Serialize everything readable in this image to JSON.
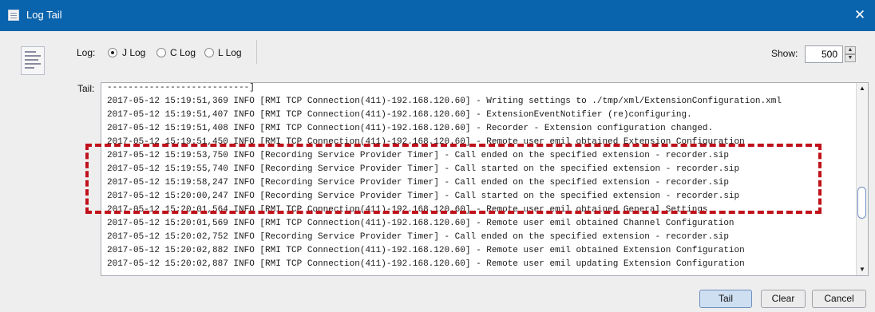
{
  "window": {
    "title": "Log Tail",
    "close_glyph": "✕"
  },
  "log_selector": {
    "label": "Log:",
    "options": [
      {
        "label": "J Log",
        "selected": true
      },
      {
        "label": "C Log",
        "selected": false
      },
      {
        "label": "L Log",
        "selected": false
      }
    ]
  },
  "show": {
    "label": "Show:",
    "value": "500"
  },
  "tail": {
    "label": "Tail:",
    "lines": [
      "---------------------------]",
      "2017-05-12 15:19:51,369 INFO [RMI TCP Connection(411)-192.168.120.60] - Writing settings to ./tmp/xml/ExtensionConfiguration.xml",
      "2017-05-12 15:19:51,407 INFO [RMI TCP Connection(411)-192.168.120.60] - ExtensionEventNotifier (re)configuring.",
      "2017-05-12 15:19:51,408 INFO [RMI TCP Connection(411)-192.168.120.60] - Recorder - Extension configuration changed.",
      "2017-05-12 15:19:51,450 INFO [RMI TCP Connection(411)-192.168.120.60] - Remote user emil obtained Extension Configuration",
      "2017-05-12 15:19:53,750 INFO [Recording Service Provider Timer] - Call ended on the specified extension - recorder.sip",
      "2017-05-12 15:19:55,740 INFO [Recording Service Provider Timer] - Call started on the specified extension - recorder.sip",
      "2017-05-12 15:19:58,247 INFO [Recording Service Provider Timer] - Call ended on the specified extension - recorder.sip",
      "2017-05-12 15:20:00,247 INFO [Recording Service Provider Timer] - Call started on the specified extension - recorder.sip",
      "2017-05-12 15:20:01,564 INFO [RMI TCP Connection(411)-192.168.120.60] - Remote user emil obtained General Settings",
      "2017-05-12 15:20:01,569 INFO [RMI TCP Connection(411)-192.168.120.60] - Remote user emil obtained Channel Configuration",
      "2017-05-12 15:20:02,752 INFO [Recording Service Provider Timer] - Call ended on the specified extension - recorder.sip",
      "2017-05-12 15:20:02,882 INFO [RMI TCP Connection(411)-192.168.120.60] - Remote user emil obtained Extension Configuration",
      "2017-05-12 15:20:02,887 INFO [RMI TCP Connection(411)-192.168.120.60] - Remote user emil updating Extension Configuration"
    ]
  },
  "buttons": {
    "tail": "Tail",
    "clear": "Clear",
    "cancel": "Cancel"
  },
  "icons": {
    "app": "log-window-icon",
    "log_document": "log-document-icon",
    "close": "close-icon",
    "spin_up": "chevron-up-icon",
    "spin_down": "chevron-down-icon"
  },
  "colors": {
    "titlebar": "#0a64ad",
    "highlight_annotation": "#c0111a",
    "window_background": "#eeeeee"
  }
}
